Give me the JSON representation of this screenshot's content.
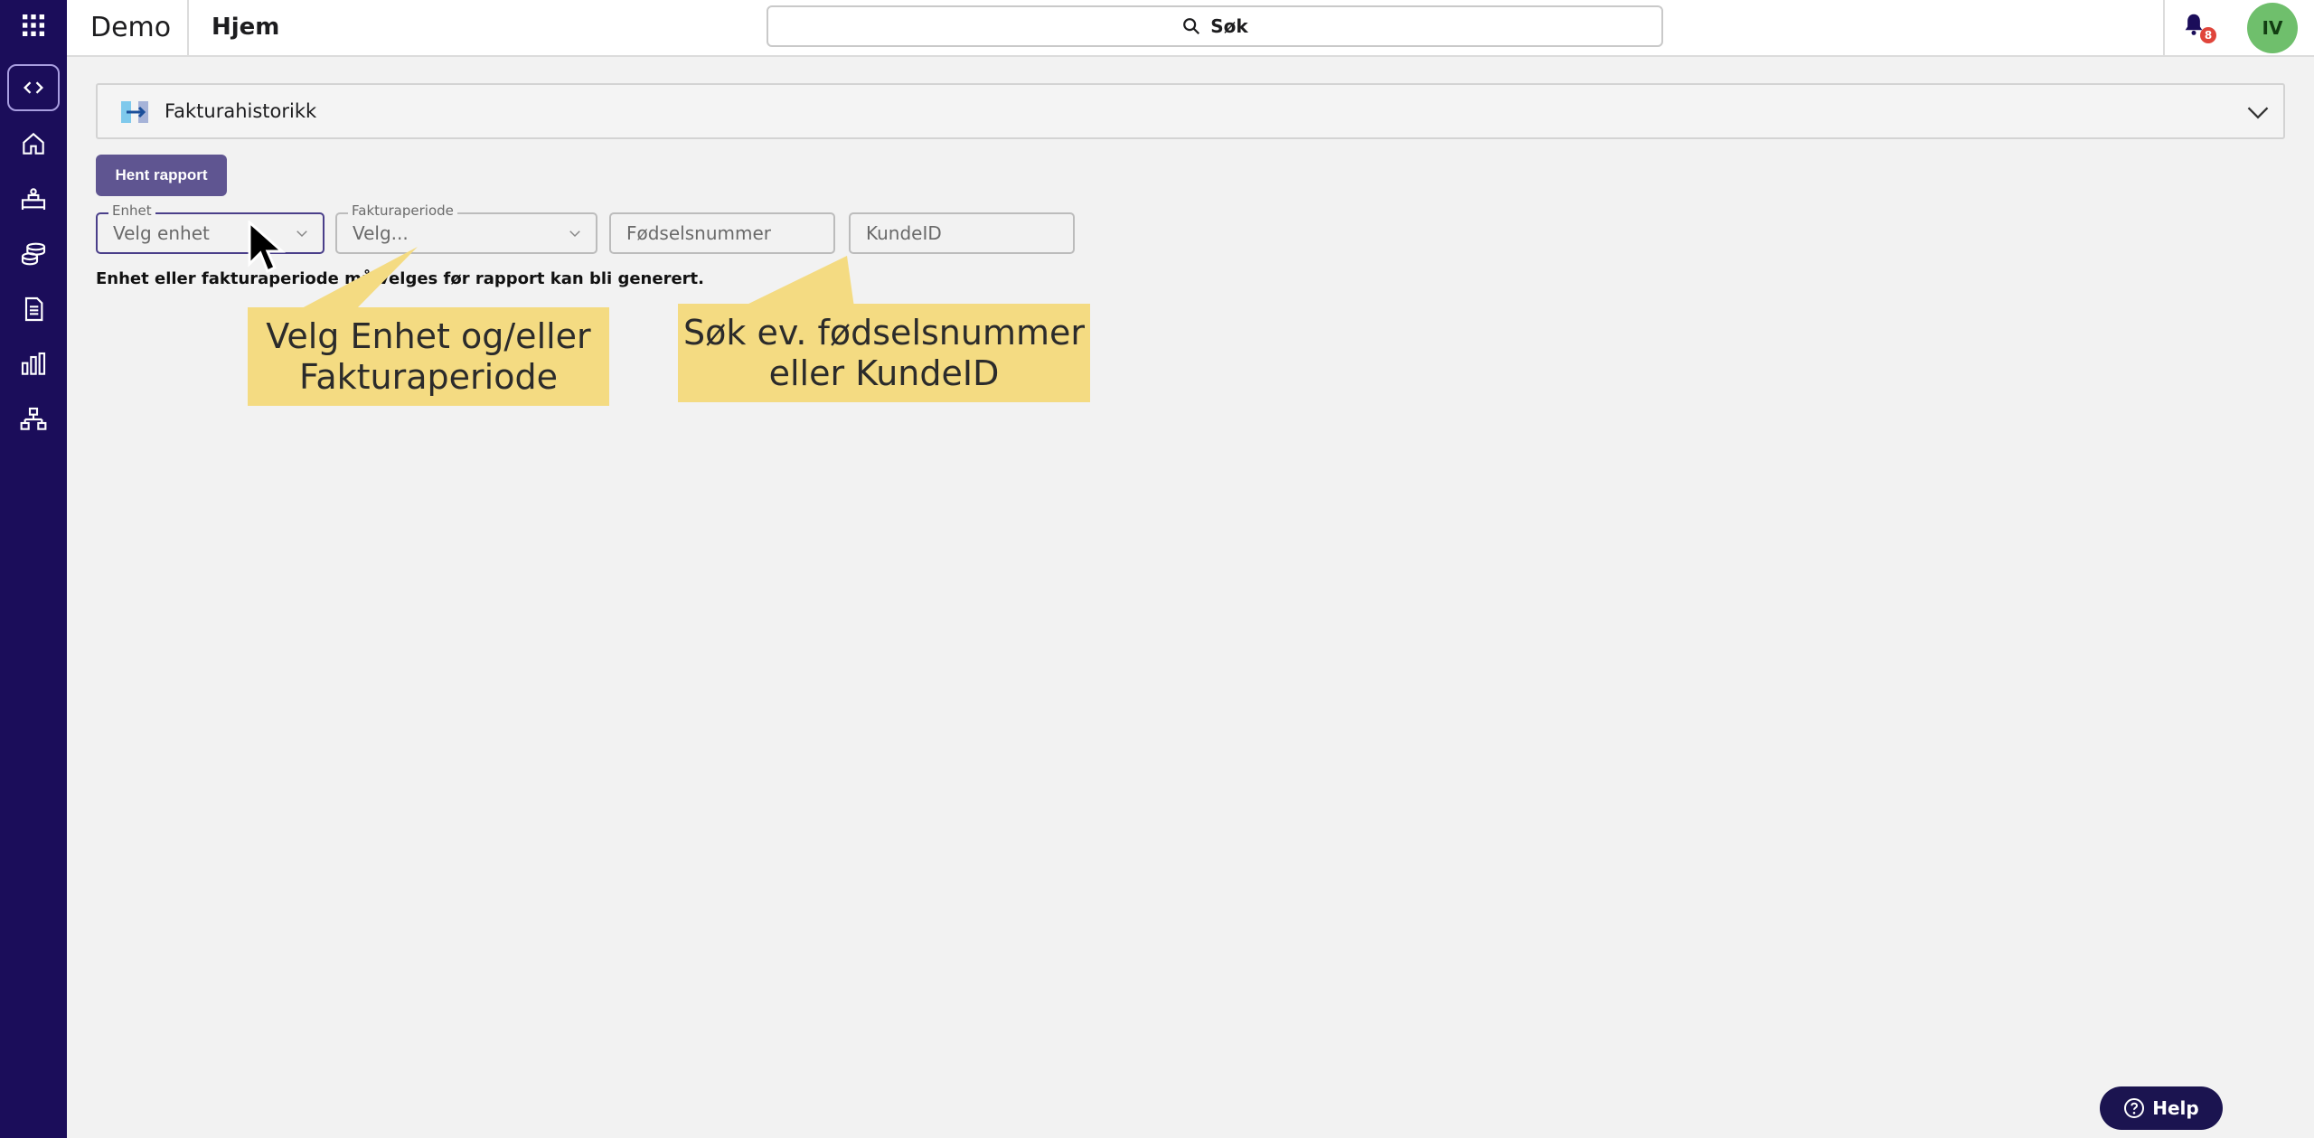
{
  "topbar": {
    "app_name": "Demo",
    "page": "Hjem",
    "search_label": "Søk",
    "notification_count": "8",
    "avatar_initials": "IV"
  },
  "sidebar": {
    "icons": [
      "apps-grid-icon",
      "code-icon",
      "home-icon",
      "bed-icon",
      "coins-icon",
      "document-icon",
      "bar-chart-icon",
      "org-chart-icon"
    ]
  },
  "report": {
    "title": "Fakturahistorikk",
    "fetch_button": "Hent rapport"
  },
  "filters": {
    "unit": {
      "label": "Enhet",
      "placeholder": "Velg enhet"
    },
    "period": {
      "label": "Fakturaperiode",
      "placeholder": "Velg..."
    },
    "ssn": {
      "placeholder": "Fødselsnummer"
    },
    "customer": {
      "placeholder": "KundeID"
    }
  },
  "warning": "Enhet eller fakturaperiode må velges før rapport kan bli generert.",
  "callouts": {
    "left": "Velg Enhet og/eller Fakturaperiode",
    "right": "Søk ev. fødselsnummer eller KundeID"
  },
  "help": {
    "label": "Help"
  },
  "colors": {
    "sidebar": "#1b0d5a",
    "primary_button": "#5f5591",
    "callout": "#f4db82",
    "avatar": "#6fbf6c",
    "badge": "#e0453b"
  }
}
